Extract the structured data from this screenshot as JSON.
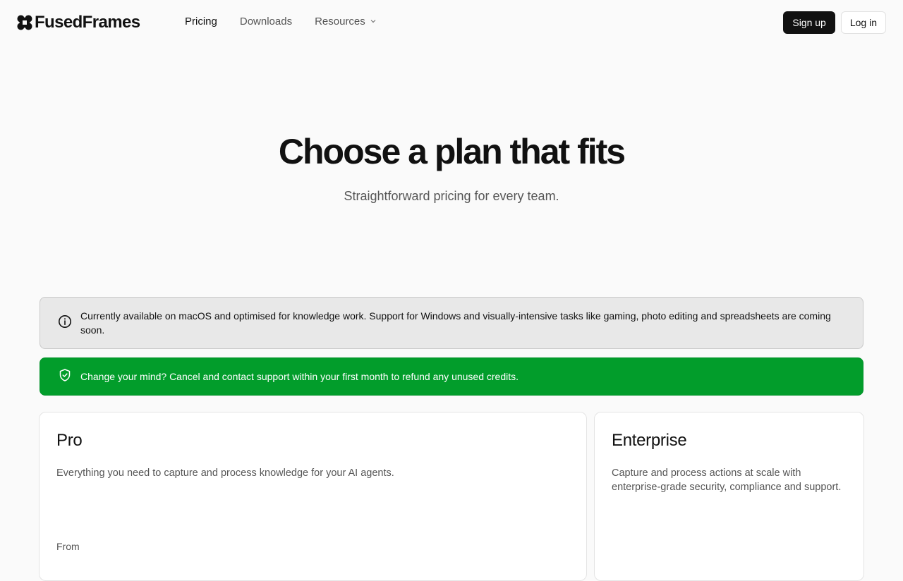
{
  "brand": {
    "name": "FusedFrames"
  },
  "nav": {
    "items": [
      {
        "label": "Pricing",
        "active": true
      },
      {
        "label": "Downloads",
        "active": false
      }
    ],
    "resources_label": "Resources"
  },
  "auth": {
    "signup_label": "Sign up",
    "login_label": "Log in"
  },
  "hero": {
    "title": "Choose a plan that fits",
    "subtitle": "Straightforward pricing for every team."
  },
  "notices": {
    "info": "Currently available on macOS and optimised for knowledge work. Support for Windows and visually-intensive tasks like gaming, photo editing and spreadsheets are coming soon.",
    "success": "Change your mind? Cancel and contact support within your first month to refund any unused credits."
  },
  "plans": [
    {
      "name": "Pro",
      "description": "Everything you need to capture and process knowledge for your AI agents.",
      "price_prefix": "From"
    },
    {
      "name": "Enterprise",
      "description": "Capture and process actions at scale with enterprise-grade security, compliance and support."
    }
  ],
  "colors": {
    "success": "#029d2b",
    "info_bg": "#e8e8e8",
    "primary": "#111111"
  },
  "icons": {
    "logo": "four-lobed-logo-icon",
    "dropdown": "chevron-down-icon",
    "info": "info-circle-icon",
    "success": "shield-check-icon"
  }
}
